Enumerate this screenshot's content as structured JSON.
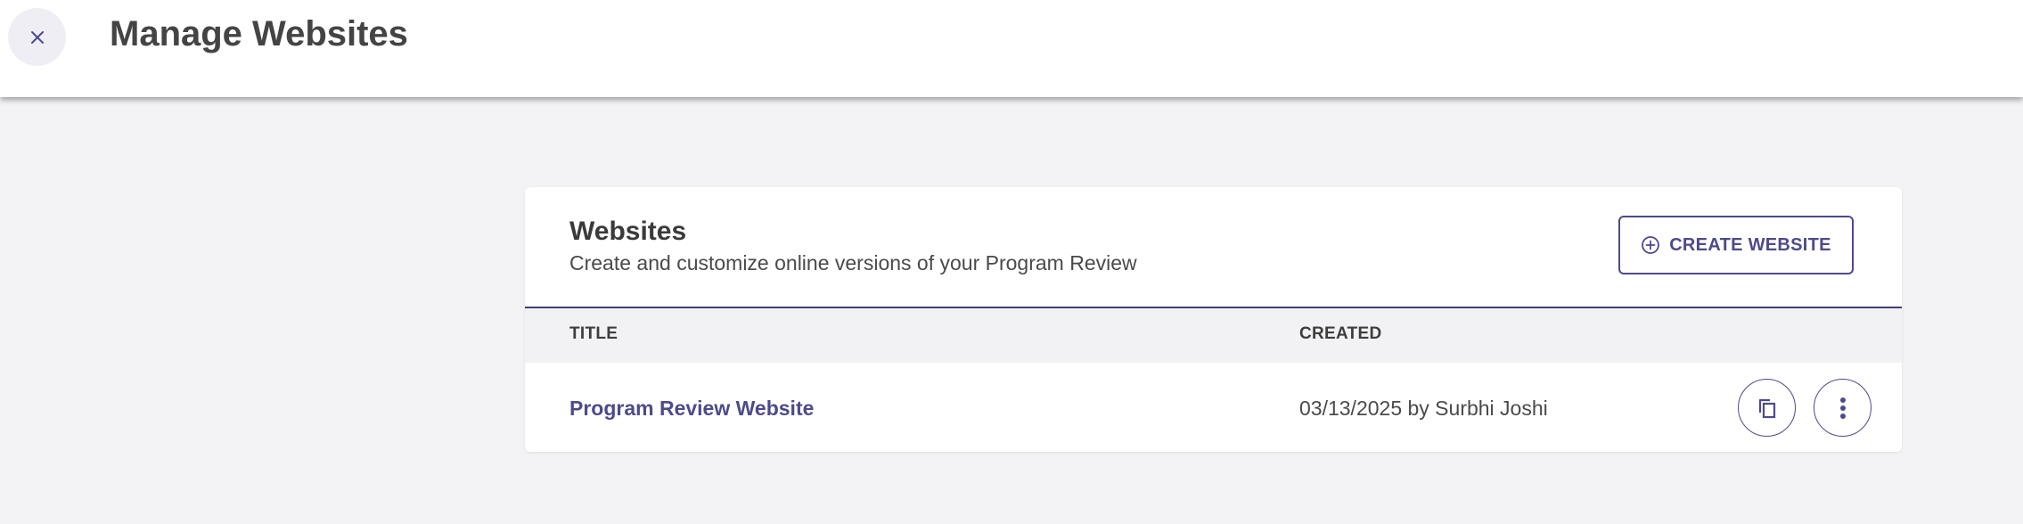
{
  "header": {
    "title": "Manage Websites",
    "close_icon": "close-icon"
  },
  "card": {
    "title": "Websites",
    "subtitle": "Create and customize online versions of your Program Review",
    "create_button": {
      "label": "CREATE WEBSITE",
      "icon": "add-circle-icon"
    }
  },
  "table": {
    "columns": [
      "TITLE",
      "CREATED"
    ],
    "rows": [
      {
        "title": "Program Review Website",
        "created": "03/13/2025 by Surbhi Joshi",
        "actions": [
          "copy-icon",
          "more-vertical-icon"
        ]
      }
    ]
  },
  "colors": {
    "accent": "#4d4a8c",
    "page_background": "#f3f3f5",
    "header_row_background": "#f2f2f4"
  }
}
